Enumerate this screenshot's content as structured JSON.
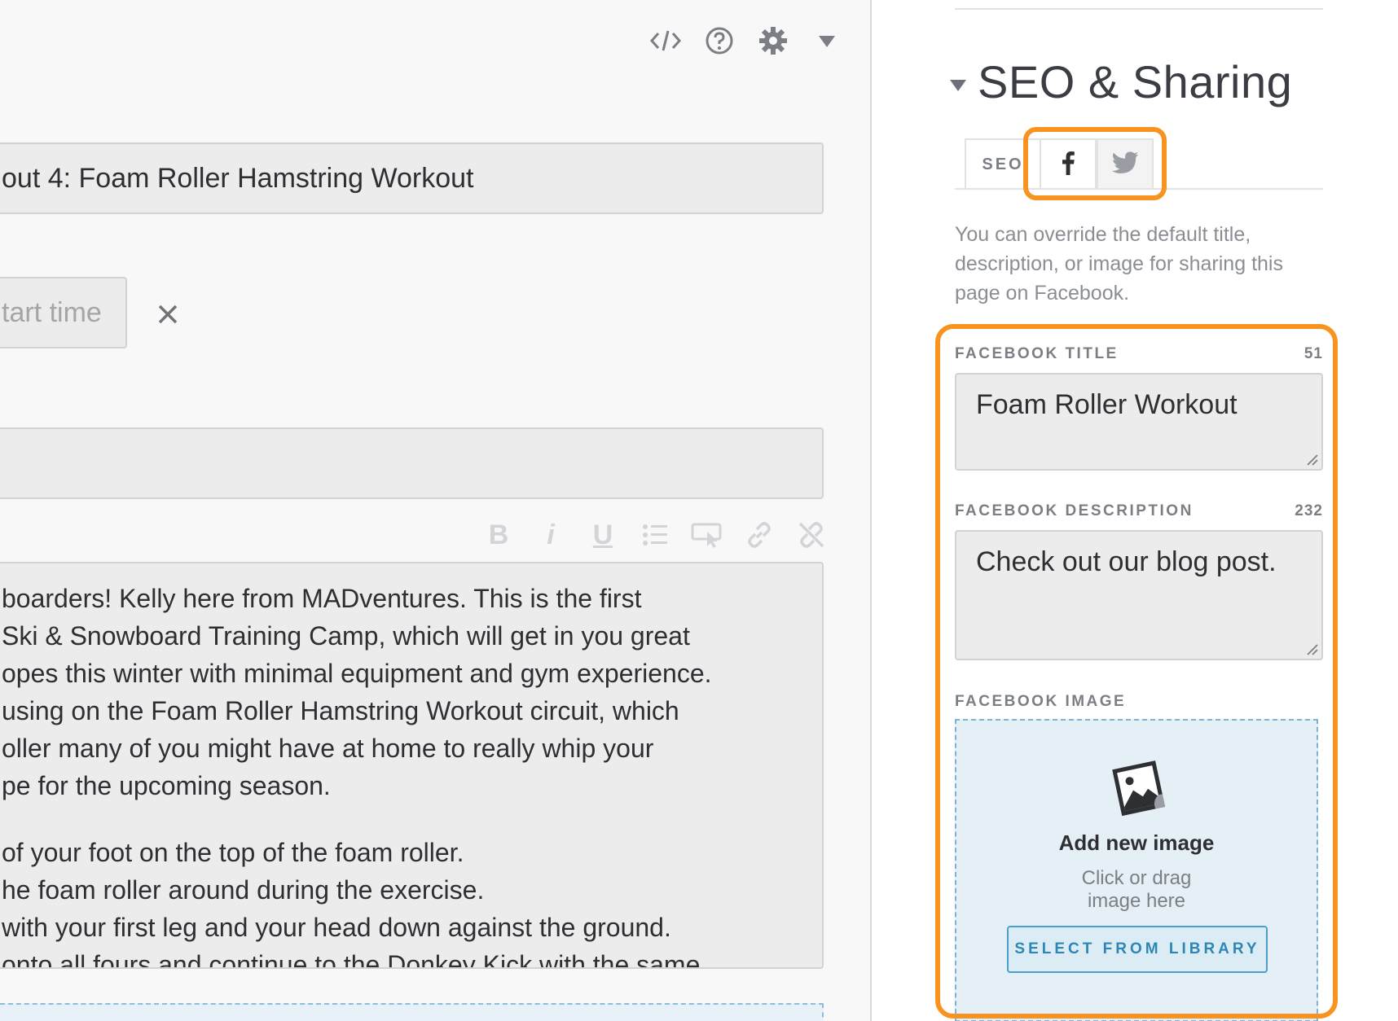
{
  "editor": {
    "title_value": "out 4: Foam Roller Hamstring Workout",
    "time_placeholder": "tart time",
    "format_buttons": [
      "B",
      "i",
      "U"
    ],
    "body_paragraph_1": [
      "boarders! Kelly here from MADventures. This is the first",
      " Ski & Snowboard Training Camp, which will get in you great",
      "opes this winter with minimal equipment and gym experience.",
      "using on the Foam Roller Hamstring Workout circuit, which",
      "oller many of you might have at home to really whip your",
      "pe for the upcoming season."
    ],
    "body_paragraph_2": [
      "of your foot on the top of the foam roller.",
      "he foam roller around during the exercise.",
      "with your first leg and your head down against the ground.",
      "onto all fours and continue to the Donkey Kick with the same"
    ]
  },
  "sidebar": {
    "section_title": "SEO & Sharing",
    "tabs": [
      {
        "label": "SEO"
      },
      {
        "icon": "facebook-icon"
      },
      {
        "icon": "twitter-icon"
      }
    ],
    "help_text": "You can override the default title, description, or image for sharing this page on Facebook.",
    "facebook_title": {
      "label": "FACEBOOK TITLE",
      "count": "51",
      "value": "Foam Roller Workout"
    },
    "facebook_description": {
      "label": "FACEBOOK DESCRIPTION",
      "count": "232",
      "value": "Check out our blog post."
    },
    "facebook_image": {
      "label": "FACEBOOK IMAGE",
      "title": "Add new image",
      "subtitle_line1": "Click or drag",
      "subtitle_line2": "image here",
      "button": "SELECT FROM LIBRARY"
    }
  },
  "colors": {
    "highlight": "#f7931e",
    "accent_blue": "#2d86b5",
    "dropzone_bg": "#e5f0f6"
  }
}
